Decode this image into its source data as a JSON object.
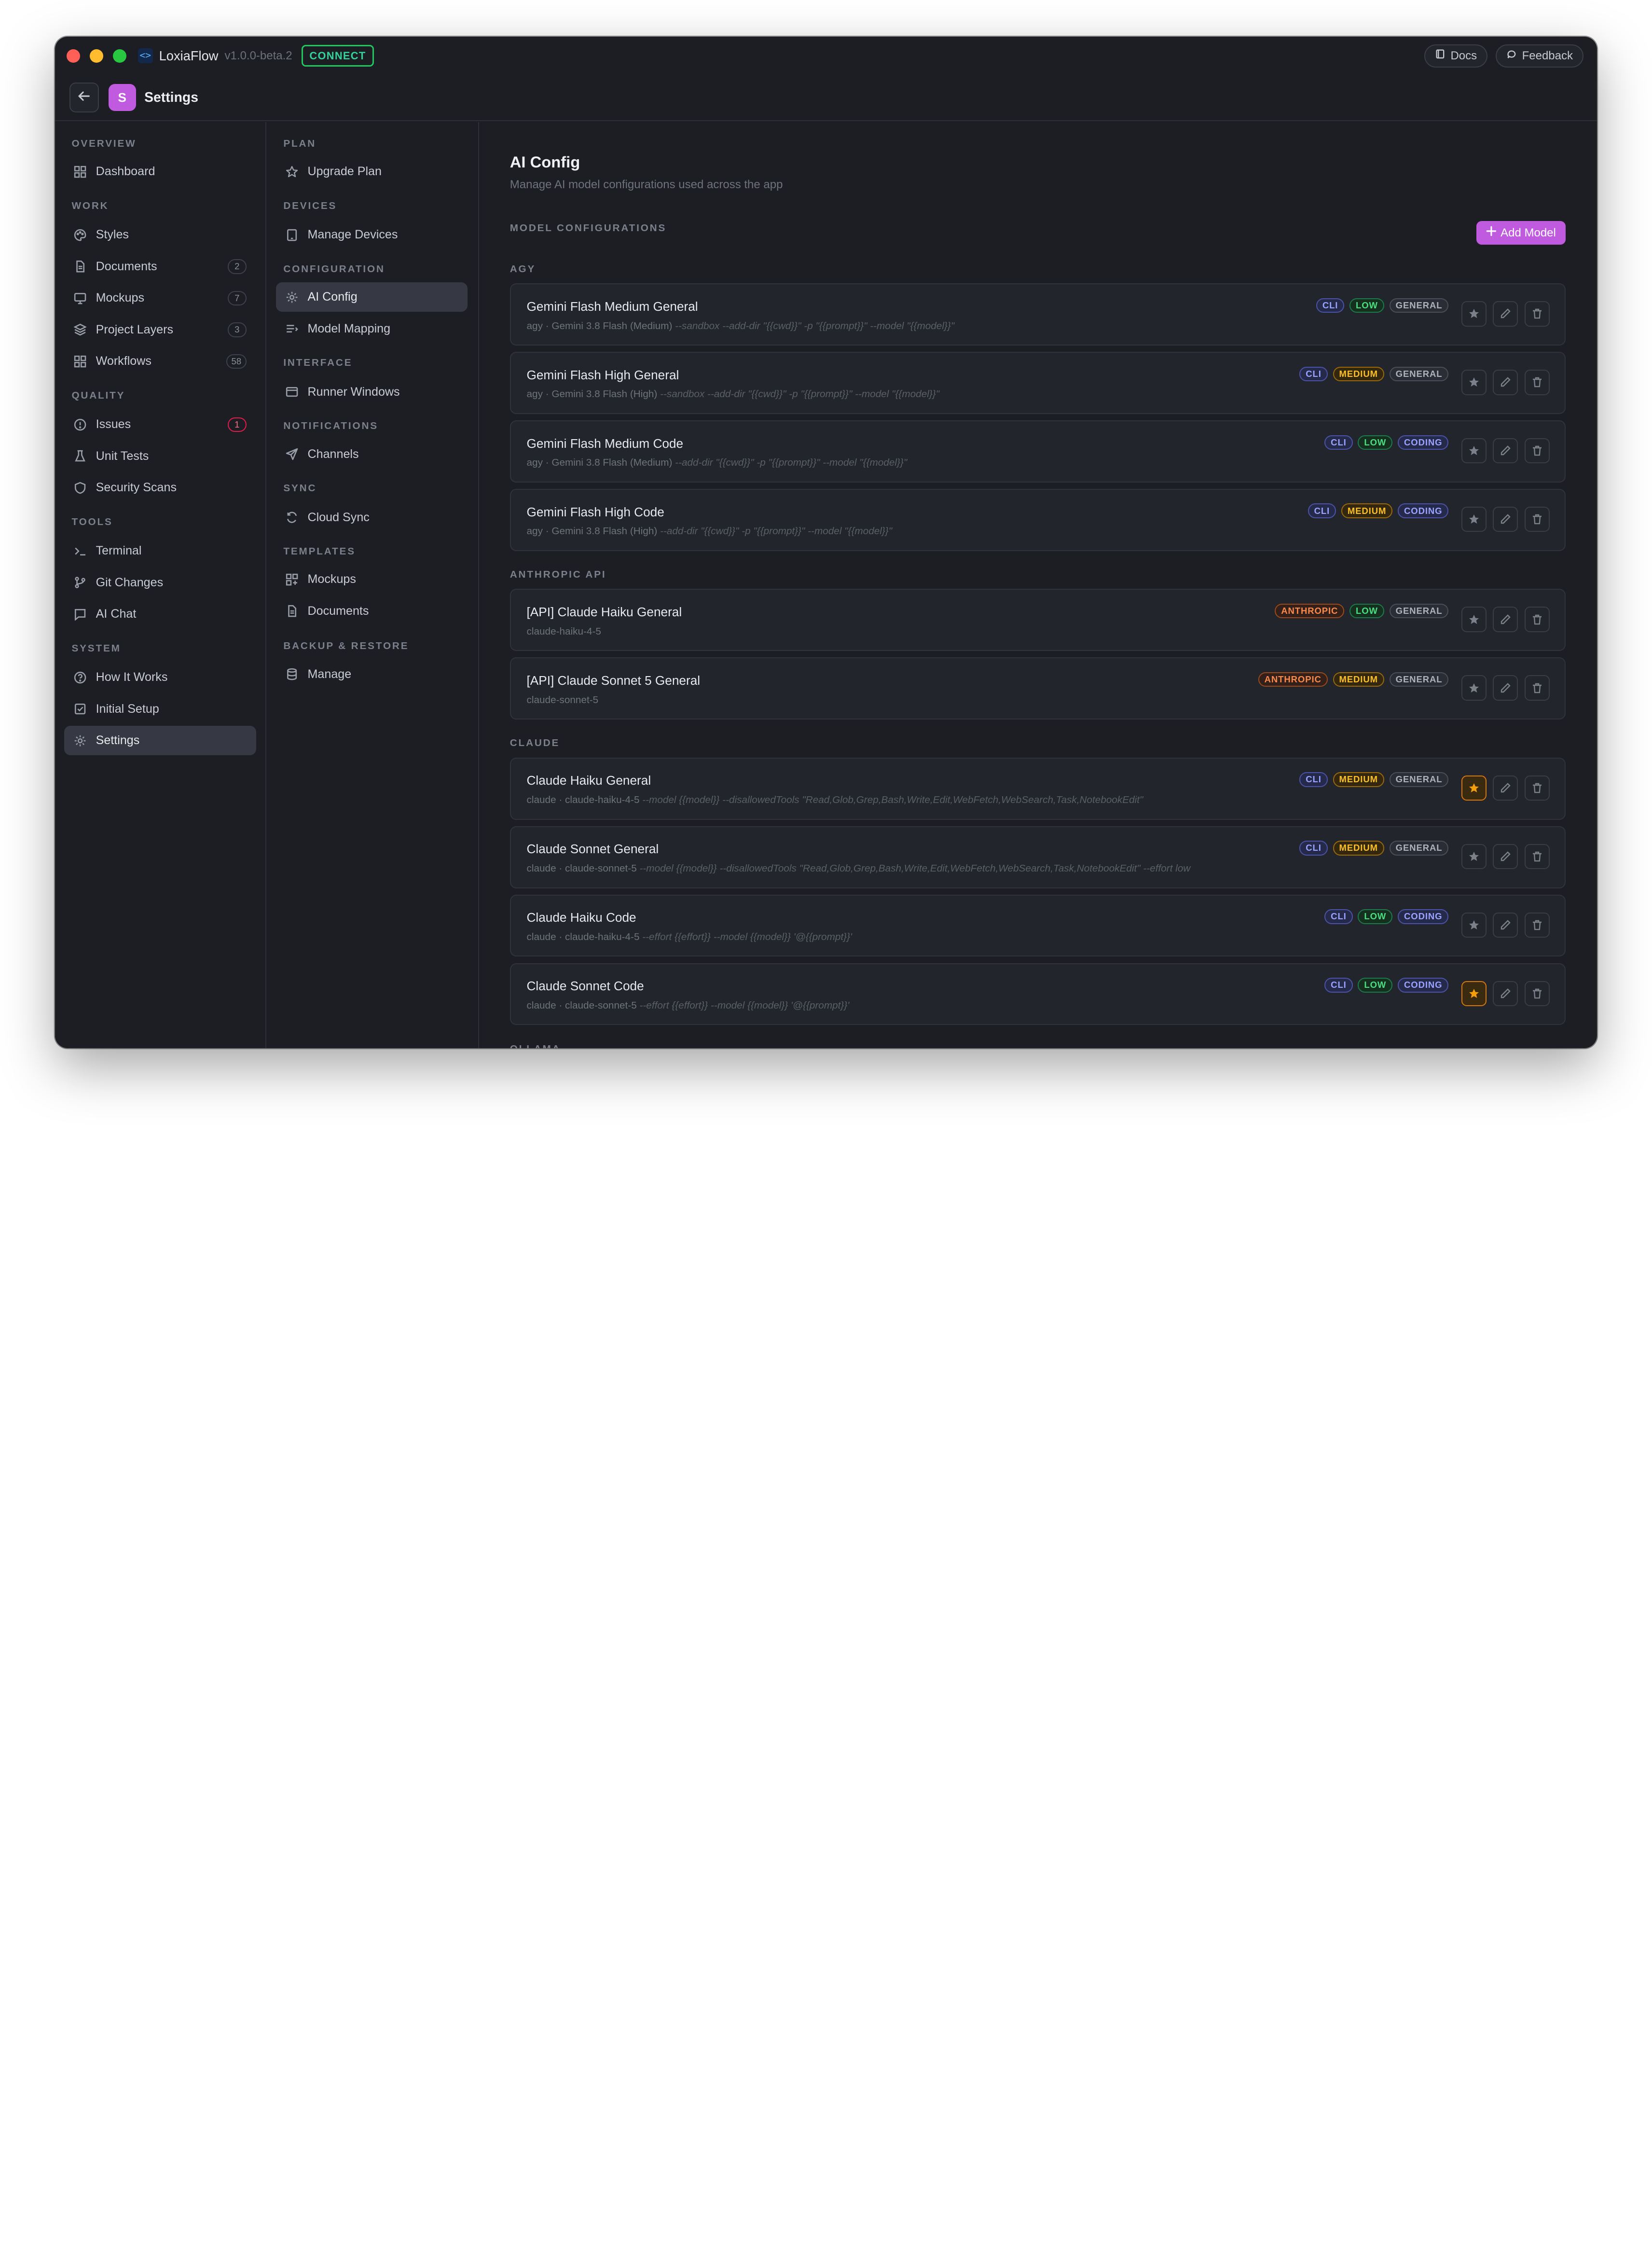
{
  "titlebar": {
    "app_name": "LoxiaFlow",
    "version": "v1.0.0-beta.2",
    "connect_label": "CONNECT",
    "docs_label": "Docs",
    "feedback_label": "Feedback"
  },
  "header": {
    "avatar_letter": "S",
    "title": "Settings"
  },
  "sidebar": {
    "sections": [
      {
        "label": "OVERVIEW",
        "items": [
          {
            "label": "Dashboard",
            "icon": "grid-icon"
          }
        ]
      },
      {
        "label": "WORK",
        "items": [
          {
            "label": "Styles",
            "icon": "palette-icon"
          },
          {
            "label": "Documents",
            "icon": "document-icon",
            "count": "2"
          },
          {
            "label": "Mockups",
            "icon": "monitor-icon",
            "count": "7"
          },
          {
            "label": "Project Layers",
            "icon": "layers-icon",
            "count": "3"
          },
          {
            "label": "Workflows",
            "icon": "grid-icon",
            "count": "58"
          }
        ]
      },
      {
        "label": "QUALITY",
        "items": [
          {
            "label": "Issues",
            "icon": "alert-circle-icon",
            "count": "1",
            "alert": true
          },
          {
            "label": "Unit Tests",
            "icon": "flask-icon"
          },
          {
            "label": "Security Scans",
            "icon": "shield-icon"
          }
        ]
      },
      {
        "label": "TOOLS",
        "items": [
          {
            "label": "Terminal",
            "icon": "terminal-icon"
          },
          {
            "label": "Git Changes",
            "icon": "git-branch-icon"
          },
          {
            "label": "AI Chat",
            "icon": "chat-icon"
          }
        ]
      },
      {
        "label": "SYSTEM",
        "items": [
          {
            "label": "How It Works",
            "icon": "help-circle-icon"
          },
          {
            "label": "Initial Setup",
            "icon": "check-square-icon"
          },
          {
            "label": "Settings",
            "icon": "gear-icon",
            "active": true
          }
        ]
      }
    ]
  },
  "settings_nav": {
    "sections": [
      {
        "label": "PLAN",
        "items": [
          {
            "label": "Upgrade Plan",
            "icon": "star-icon"
          }
        ]
      },
      {
        "label": "DEVICES",
        "items": [
          {
            "label": "Manage Devices",
            "icon": "device-icon"
          }
        ]
      },
      {
        "label": "CONFIGURATION",
        "items": [
          {
            "label": "AI Config",
            "icon": "gear-icon",
            "active": true
          },
          {
            "label": "Model Mapping",
            "icon": "list-icon"
          }
        ]
      },
      {
        "label": "INTERFACE",
        "items": [
          {
            "label": "Runner Windows",
            "icon": "window-icon"
          }
        ]
      },
      {
        "label": "NOTIFICATIONS",
        "items": [
          {
            "label": "Channels",
            "icon": "send-icon"
          }
        ]
      },
      {
        "label": "SYNC",
        "items": [
          {
            "label": "Cloud Sync",
            "icon": "sync-icon"
          }
        ]
      },
      {
        "label": "TEMPLATES",
        "items": [
          {
            "label": "Mockups",
            "icon": "grid-plus-icon"
          },
          {
            "label": "Documents",
            "icon": "document-icon"
          }
        ]
      },
      {
        "label": "BACKUP & RESTORE",
        "items": [
          {
            "label": "Manage",
            "icon": "database-icon"
          }
        ]
      }
    ]
  },
  "main": {
    "title": "AI Config",
    "subtitle": "Manage AI model configurations used across the app",
    "section_label": "MODEL CONFIGURATIONS",
    "add_button": "Add Model",
    "groups": [
      {
        "label": "AGY",
        "models": [
          {
            "name": "Gemini Flash Medium General",
            "cmd": "agy · Gemini 3.8 Flash (Medium)",
            "args": "--sandbox --add-dir \"{{cwd}}\" -p \"{{prompt}}\" --model \"{{model}}\"",
            "tags": [
              "CLI",
              "LOW",
              "GENERAL"
            ],
            "starred": false
          },
          {
            "name": "Gemini Flash High General",
            "cmd": "agy · Gemini 3.8 Flash (High)",
            "args": "--sandbox --add-dir \"{{cwd}}\" -p \"{{prompt}}\" --model \"{{model}}\"",
            "tags": [
              "CLI",
              "MEDIUM",
              "GENERAL"
            ],
            "starred": false
          },
          {
            "name": "Gemini Flash Medium Code",
            "cmd": "agy · Gemini 3.8 Flash (Medium)",
            "args": "--add-dir \"{{cwd}}\" -p \"{{prompt}}\" --model \"{{model}}\"",
            "tags": [
              "CLI",
              "LOW",
              "CODING"
            ],
            "starred": false
          },
          {
            "name": "Gemini Flash High Code",
            "cmd": "agy · Gemini 3.8 Flash (High)",
            "args": "--add-dir \"{{cwd}}\" -p \"{{prompt}}\" --model \"{{model}}\"",
            "tags": [
              "CLI",
              "MEDIUM",
              "CODING"
            ],
            "starred": false
          }
        ]
      },
      {
        "label": "ANTHROPIC API",
        "models": [
          {
            "name": "[API] Claude Haiku General",
            "cmd": "claude-haiku-4-5",
            "args": "",
            "tags": [
              "ANTHROPIC",
              "LOW",
              "GENERAL"
            ],
            "starred": false
          },
          {
            "name": "[API] Claude Sonnet 5 General",
            "cmd": "claude-sonnet-5",
            "args": "",
            "tags": [
              "ANTHROPIC",
              "MEDIUM",
              "GENERAL"
            ],
            "starred": false
          }
        ]
      },
      {
        "label": "CLAUDE",
        "models": [
          {
            "name": "Claude Haiku General",
            "cmd": "claude · claude-haiku-4-5",
            "args": "--model {{model}} --disallowedTools \"Read,Glob,Grep,Bash,Write,Edit,WebFetch,WebSearch,Task,NotebookEdit\"",
            "tags": [
              "CLI",
              "MEDIUM",
              "GENERAL"
            ],
            "starred": true
          },
          {
            "name": "Claude Sonnet General",
            "cmd": "claude · claude-sonnet-5",
            "args": "--model {{model}} --disallowedTools \"Read,Glob,Grep,Bash,Write,Edit,WebFetch,WebSearch,Task,NotebookEdit\" --effort low",
            "tags": [
              "CLI",
              "MEDIUM",
              "GENERAL"
            ],
            "starred": false
          },
          {
            "name": "Claude Haiku Code",
            "cmd": "claude · claude-haiku-4-5",
            "args": "--effort {{effort}} --model {{model}} '@{{prompt}}'",
            "tags": [
              "CLI",
              "LOW",
              "CODING"
            ],
            "starred": false
          },
          {
            "name": "Claude Sonnet Code",
            "cmd": "claude · claude-sonnet-5",
            "args": "--effort {{effort}} --model {{model}} '@{{prompt}}'",
            "tags": [
              "CLI",
              "LOW",
              "CODING"
            ],
            "starred": true
          }
        ]
      },
      {
        "label": "OLLAMA",
        "models": []
      }
    ]
  },
  "colors": {
    "accent": "#c05be0",
    "connect": "#22c55e",
    "star_active": "#f59e0b",
    "window_bg": "#1c1e24",
    "card_bg": "#22252c"
  }
}
